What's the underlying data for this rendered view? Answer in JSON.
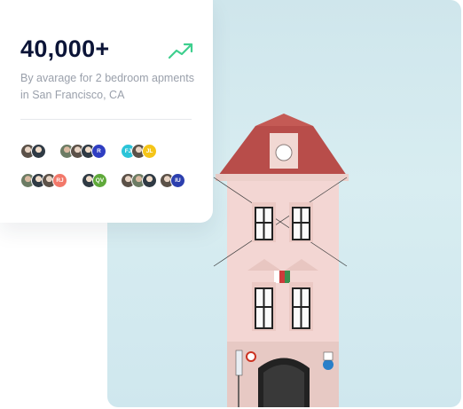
{
  "stats": {
    "headline": "40,000+",
    "description": "By avarage for 2 bedroom apments in San Francisco, CA",
    "trend_icon": "trending-up-icon",
    "trend_color": "#3ecf8e"
  },
  "avatar_groups": [
    [
      {
        "kind": "photo"
      },
      {
        "kind": "photo"
      }
    ],
    [
      {
        "kind": "photo"
      },
      {
        "kind": "photo"
      },
      {
        "kind": "photo"
      },
      {
        "kind": "initials",
        "text": "R",
        "color": "#2f3ec2"
      }
    ],
    [
      {
        "kind": "initials",
        "text": "FJ",
        "color": "#2bc4d8"
      },
      {
        "kind": "photo"
      },
      {
        "kind": "initials",
        "text": "JL",
        "color": "#f5c518"
      }
    ],
    [
      {
        "kind": "photo"
      },
      {
        "kind": "photo"
      },
      {
        "kind": "photo"
      },
      {
        "kind": "initials",
        "text": "RJ",
        "color": "#f2786a"
      }
    ],
    [
      {
        "kind": "photo"
      },
      {
        "kind": "initials",
        "text": "QV",
        "color": "#5fa93a"
      }
    ],
    [
      {
        "kind": "photo"
      },
      {
        "kind": "photo"
      },
      {
        "kind": "photo"
      }
    ],
    [
      {
        "kind": "photo"
      },
      {
        "kind": "initials",
        "text": "IU",
        "color": "#2c3fae"
      }
    ]
  ],
  "colors": {
    "headline": "#0b1437",
    "sky": "#d3eaef",
    "building": "#f3d6d3",
    "roof": "#b84d4a"
  }
}
